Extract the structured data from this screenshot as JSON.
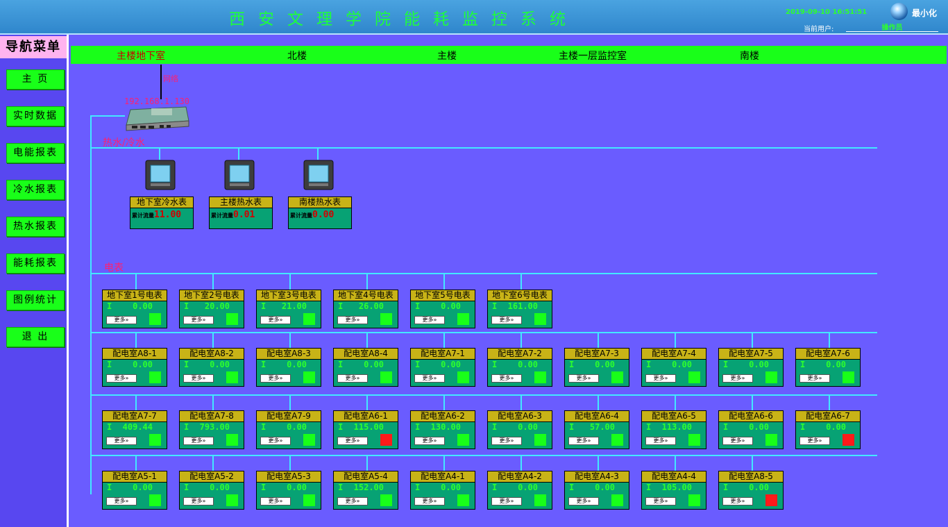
{
  "header": {
    "title": "西安文理学院能耗监控系统",
    "datetime": "2019-09-10 16:51:51",
    "minimize_label": "最小化",
    "user_label": "当前用户:",
    "user_value": "操作员"
  },
  "nav": {
    "title": "导航菜单",
    "items": [
      "主 页",
      "实时数据",
      "电能报表",
      "冷水报表",
      "热水报表",
      "能耗报表",
      "图例统计",
      "退 出"
    ]
  },
  "buildings": [
    "主楼地下室",
    "北楼",
    "主楼",
    "主楼一层监控室",
    "南楼"
  ],
  "gateway": {
    "net_label": "网络",
    "ip": "192.168.1.130"
  },
  "water": {
    "section_label": "热水/冷水",
    "meters": [
      {
        "name": "地下室冷水表",
        "label": "累计流量",
        "value": "11.00"
      },
      {
        "name": "主楼热水表",
        "label": "累计流量",
        "value": "0.01"
      },
      {
        "name": "南楼热水表",
        "label": "累计流量",
        "value": "0.00"
      }
    ]
  },
  "electric": {
    "section_label": "电表",
    "current_symbol": "I",
    "more_label": "更多»",
    "rows": [
      [
        {
          "name": "地下室1号电表",
          "value": "0.00",
          "status": "ok"
        },
        {
          "name": "地下室2号电表",
          "value": "20.00",
          "status": "ok"
        },
        {
          "name": "地下室3号电表",
          "value": "21.00",
          "status": "ok"
        },
        {
          "name": "地下室4号电表",
          "value": "26.00",
          "status": "ok"
        },
        {
          "name": "地下室5号电表",
          "value": "0.00",
          "status": "ok"
        },
        {
          "name": "地下室6号电表",
          "value": "161.00",
          "status": "ok"
        }
      ],
      [
        {
          "name": "配电室A8-1",
          "value": "0.00",
          "status": "ok"
        },
        {
          "name": "配电室A8-2",
          "value": "0.00",
          "status": "ok"
        },
        {
          "name": "配电室A8-3",
          "value": "0.00",
          "status": "ok"
        },
        {
          "name": "配电室A8-4",
          "value": "0.00",
          "status": "ok"
        },
        {
          "name": "配电室A7-1",
          "value": "0.00",
          "status": "ok"
        },
        {
          "name": "配电室A7-2",
          "value": "0.00",
          "status": "ok"
        },
        {
          "name": "配电室A7-3",
          "value": "0.00",
          "status": "ok"
        },
        {
          "name": "配电室A7-4",
          "value": "0.00",
          "status": "ok"
        },
        {
          "name": "配电室A7-5",
          "value": "0.00",
          "status": "ok"
        },
        {
          "name": "配电室A7-6",
          "value": "0.00",
          "status": "ok"
        }
      ],
      [
        {
          "name": "配电室A7-7",
          "value": "409.44",
          "status": "ok"
        },
        {
          "name": "配电室A7-8",
          "value": "793.00",
          "status": "ok"
        },
        {
          "name": "配电室A7-9",
          "value": "0.00",
          "status": "ok"
        },
        {
          "name": "配电室A6-1",
          "value": "115.00",
          "status": "alarm"
        },
        {
          "name": "配电室A6-2",
          "value": "130.00",
          "status": "ok"
        },
        {
          "name": "配电室A6-3",
          "value": "0.00",
          "status": "ok"
        },
        {
          "name": "配电室A6-4",
          "value": "57.00",
          "status": "ok"
        },
        {
          "name": "配电室A6-5",
          "value": "113.00",
          "status": "ok"
        },
        {
          "name": "配电室A6-6",
          "value": "0.00",
          "status": "ok"
        },
        {
          "name": "配电室A6-7",
          "value": "0.00",
          "status": "alarm"
        }
      ],
      [
        {
          "name": "配电室A5-1",
          "value": "0.00",
          "status": "ok"
        },
        {
          "name": "配电室A5-2",
          "value": "0.00",
          "status": "ok"
        },
        {
          "name": "配电室A5-3",
          "value": "0.00",
          "status": "ok"
        },
        {
          "name": "配电室A5-4",
          "value": "152.00",
          "status": "ok"
        },
        {
          "name": "配电室A4-1",
          "value": "0.00",
          "status": "ok"
        },
        {
          "name": "配电室A4-2",
          "value": "0.00",
          "status": "ok"
        },
        {
          "name": "配电室A4-3",
          "value": "0.00",
          "status": "ok"
        },
        {
          "name": "配电室A4-4",
          "value": "105.00",
          "status": "ok"
        },
        {
          "name": "配电室A8-5",
          "value": "0.00",
          "status": "alarm"
        }
      ]
    ]
  },
  "colors": {
    "background": "#6a5cff",
    "accent_green": "#19ff19",
    "meter_header": "#c8b317",
    "meter_body": "#07a274",
    "bus_line": "#43e8ff",
    "alarm": "#ff1a1a"
  }
}
